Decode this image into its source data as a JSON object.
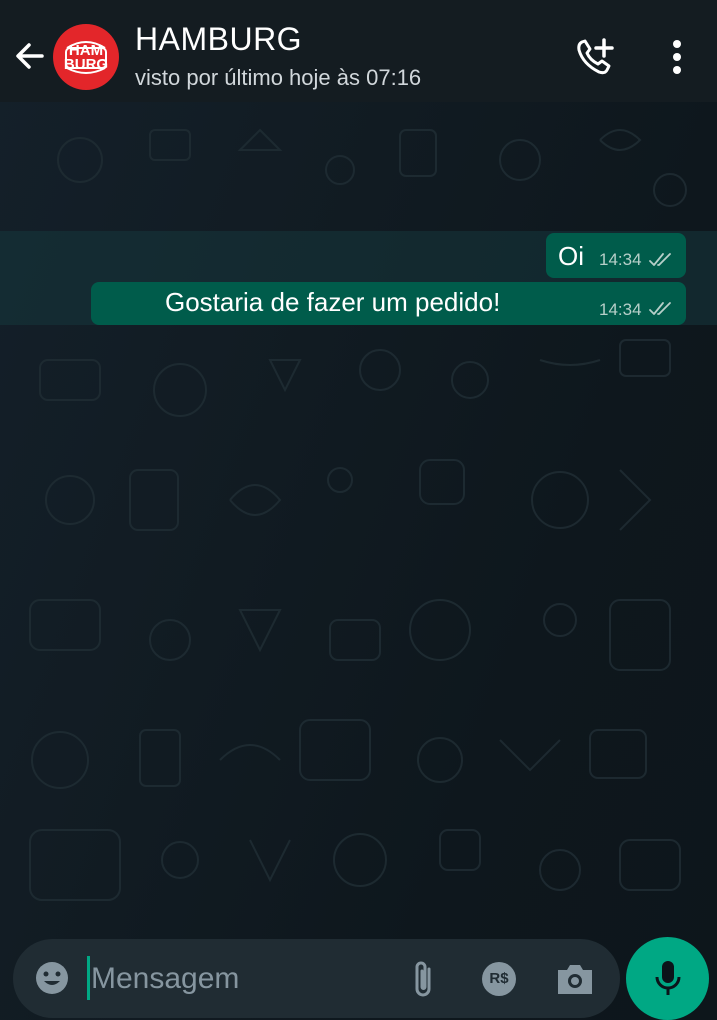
{
  "header": {
    "title": "HAMBURG",
    "status": "visto por último hoje às 07:16",
    "avatar_text_top": "HAM",
    "avatar_text_bottom": "BURG"
  },
  "messages": [
    {
      "text": "Oi",
      "time": "14:34",
      "status": "read"
    },
    {
      "text": "Gostaria de fazer um pedido!",
      "time": "14:34",
      "status": "read"
    }
  ],
  "composer": {
    "placeholder": "Mensagem",
    "payment_icon_text": "R$"
  },
  "icons": {
    "back": "arrow-left-icon",
    "add_call": "phone-plus-icon",
    "menu": "more-vert-icon",
    "emoji": "smiley-icon",
    "attach": "paperclip-icon",
    "payment": "currency-real-icon",
    "camera": "camera-icon",
    "mic": "microphone-icon",
    "read_receipt": "double-check-icon"
  },
  "colors": {
    "header_bg": "#141c21",
    "chat_bg": "#0b141a",
    "outgoing_bubble": "#005c4b",
    "accent": "#00a884",
    "avatar_bg": "#e3262a",
    "input_bg": "#202c33"
  }
}
